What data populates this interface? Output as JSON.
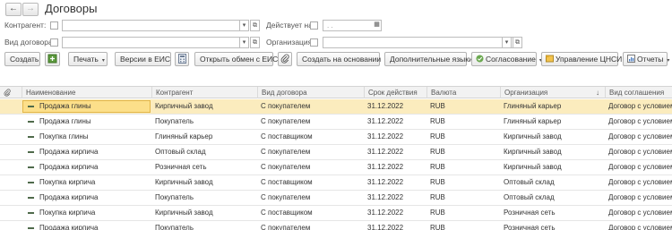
{
  "window": {
    "title": "Договоры",
    "back_icon": "←",
    "forward_icon": "→"
  },
  "filters": {
    "counterparty_label": "Контрагент:",
    "valid_on_label": "Действует на:",
    "valid_on_placeholder": ". .",
    "contract_type_label": "Вид договора:",
    "organization_label": "Организация:",
    "dropdown_icon": "▾",
    "open_icon": "⧉",
    "calendar_icon": "▦"
  },
  "toolbar": {
    "create_label": "Создать",
    "print_label": "Печать",
    "eis_versions_label": "Версии в ЕИС",
    "open_eis_exchange_label": "Открыть обмен с ЕИС",
    "create_based_on_label": "Создать на основании",
    "extra_languages_label": "Дополнительные языки",
    "approval_label": "Согласование",
    "cnsi_label": "Управление ЦНСИ",
    "reports_label": "Отчеты",
    "caret": "▾"
  },
  "table": {
    "columns": [
      "Наименование",
      "Контрагент",
      "Вид договора",
      "Срок действия",
      "Валюта",
      "Организация",
      "Вид соглашения"
    ],
    "sort_indicator": "↓",
    "rows": [
      {
        "name": "Продажа глины",
        "counterparty": "Кирпичный завод",
        "type": "С покупателем",
        "term": "31.12.2022",
        "currency": "RUB",
        "org": "Глиняный карьер",
        "agreement": "Договор с условием"
      },
      {
        "name": "Продажа глины",
        "counterparty": "Покупатель",
        "type": "С покупателем",
        "term": "31.12.2022",
        "currency": "RUB",
        "org": "Глиняный карьер",
        "agreement": "Договор с условием"
      },
      {
        "name": "Покупка глины",
        "counterparty": "Глиняный карьер",
        "type": "С поставщиком",
        "term": "31.12.2022",
        "currency": "RUB",
        "org": "Кирпичный завод",
        "agreement": "Договор с условием"
      },
      {
        "name": "Продажа кирпича",
        "counterparty": "Оптовый склад",
        "type": "С покупателем",
        "term": "31.12.2022",
        "currency": "RUB",
        "org": "Кирпичный завод",
        "agreement": "Договор с условием"
      },
      {
        "name": "Продажа кирпича",
        "counterparty": "Розничная сеть",
        "type": "С покупателем",
        "term": "31.12.2022",
        "currency": "RUB",
        "org": "Кирпичный завод",
        "agreement": "Договор с условием"
      },
      {
        "name": "Покупка кирпича",
        "counterparty": "Кирпичный завод",
        "type": "С поставщиком",
        "term": "31.12.2022",
        "currency": "RUB",
        "org": "Оптовый склад",
        "agreement": "Договор с условием"
      },
      {
        "name": "Продажа кирпича",
        "counterparty": "Покупатель",
        "type": "С покупателем",
        "term": "31.12.2022",
        "currency": "RUB",
        "org": "Оптовый склад",
        "agreement": "Договор с условием"
      },
      {
        "name": "Покупка кирпича",
        "counterparty": "Кирпичный завод",
        "type": "С поставщиком",
        "term": "31.12.2022",
        "currency": "RUB",
        "org": "Розничная сеть",
        "agreement": "Договор с условием"
      },
      {
        "name": "Продажа кирпича",
        "counterparty": "Покупатель",
        "type": "С покупателем",
        "term": "31.12.2022",
        "currency": "RUB",
        "org": "Розничная сеть",
        "agreement": "Договор с условием"
      }
    ]
  },
  "colors": {
    "selected_row": "#fbecbe",
    "selected_cell": "#fcdf8a",
    "row_icon": "#4f6a4b"
  }
}
